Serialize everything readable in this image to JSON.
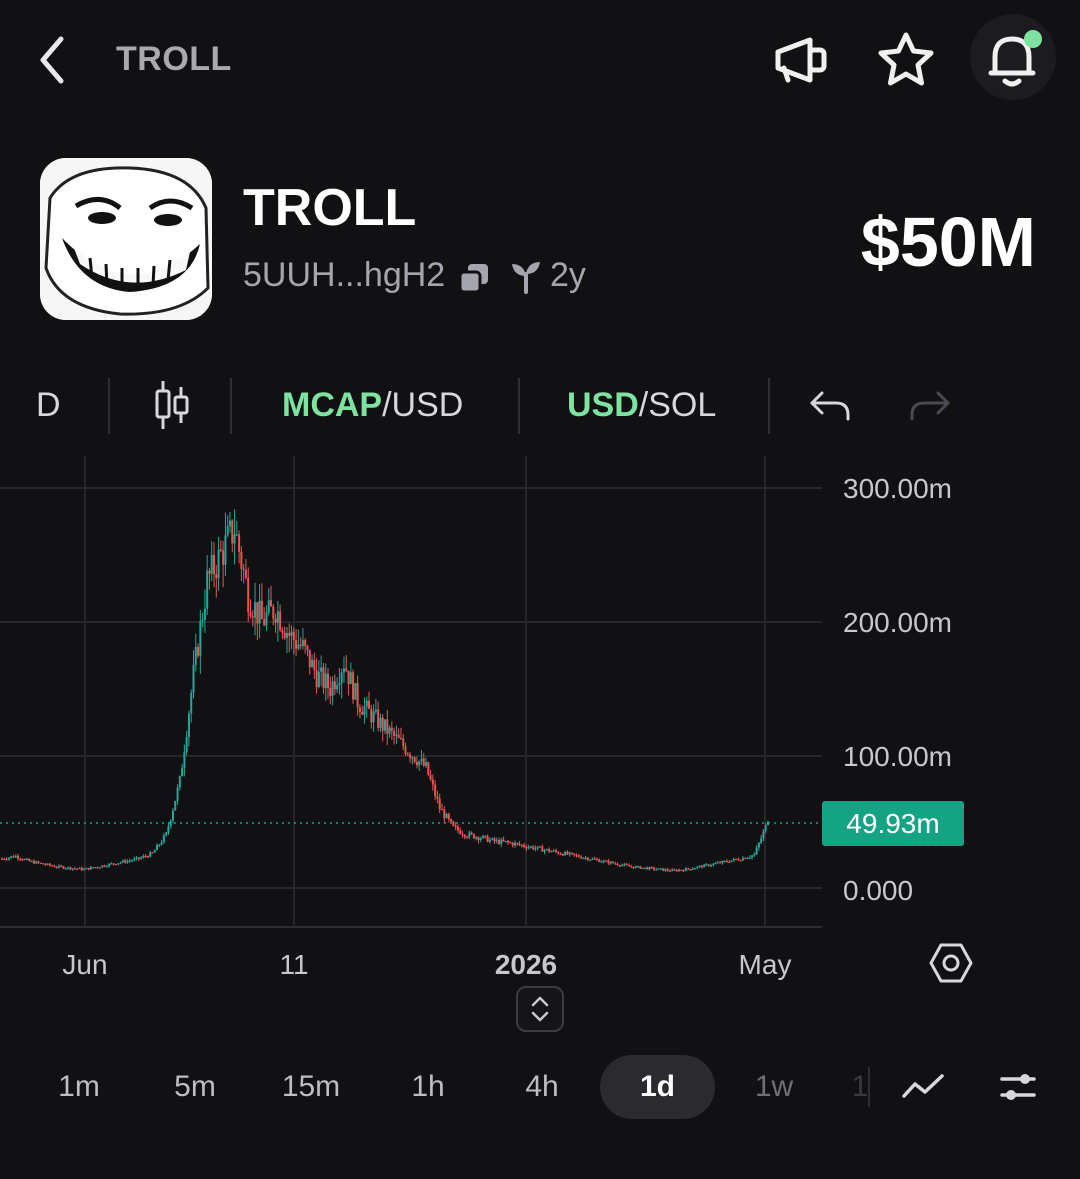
{
  "header": {
    "title": "TROLL",
    "icons": [
      "back-arrow-icon",
      "megaphone-icon",
      "star-icon",
      "bell-icon"
    ],
    "notification_dot_color": "#7ee3a0"
  },
  "token": {
    "name": "TROLL",
    "address": "5UUH...hgH2",
    "age": "2y",
    "market_cap": "$50M"
  },
  "toolbar": {
    "interval_short": "D",
    "candles_icon": "candlestick-icon",
    "mcap_toggle": {
      "active": "MCAP",
      "rest": "/USD"
    },
    "currency_toggle": {
      "active": "USD",
      "rest": "/SOL"
    },
    "undo_icon": "undo-icon",
    "redo_icon": "redo-icon",
    "accent_color": "#7ee3a0"
  },
  "chart_data": {
    "type": "candlestick",
    "y_axis_labels": [
      "300.00m",
      "200.00m",
      "100.00m",
      "0.000"
    ],
    "x_axis_labels": [
      "Jun",
      "11",
      "2026",
      "May"
    ],
    "current_value_label": "49.93m",
    "ylim": [
      0,
      300
    ],
    "unit": "m",
    "grid": true,
    "series": [
      {
        "approx_close_m": [
          22,
          24,
          20,
          18,
          16,
          15,
          14,
          16,
          18,
          20,
          22,
          26,
          40,
          80,
          160,
          230,
          250,
          270,
          220,
          200,
          210,
          190,
          180,
          160,
          150,
          170,
          140,
          130,
          120,
          110,
          100,
          90,
          60,
          45,
          40,
          38,
          35,
          34,
          32,
          30,
          28,
          26,
          24,
          22,
          20,
          18,
          16,
          15,
          14,
          13,
          14,
          16,
          18,
          20,
          22,
          25,
          49.93
        ]
      }
    ],
    "up_color": "#26a69a",
    "down_color": "#ef5350",
    "last_price_color": "#14a383"
  },
  "settings_icon": "hexagon-settings-icon",
  "intervals": {
    "items": [
      "1m",
      "5m",
      "15m",
      "1h",
      "4h",
      "1d",
      "1w",
      "1"
    ],
    "active": "1d"
  },
  "bottom_icons": [
    "line-chart-icon",
    "sliders-icon"
  ]
}
